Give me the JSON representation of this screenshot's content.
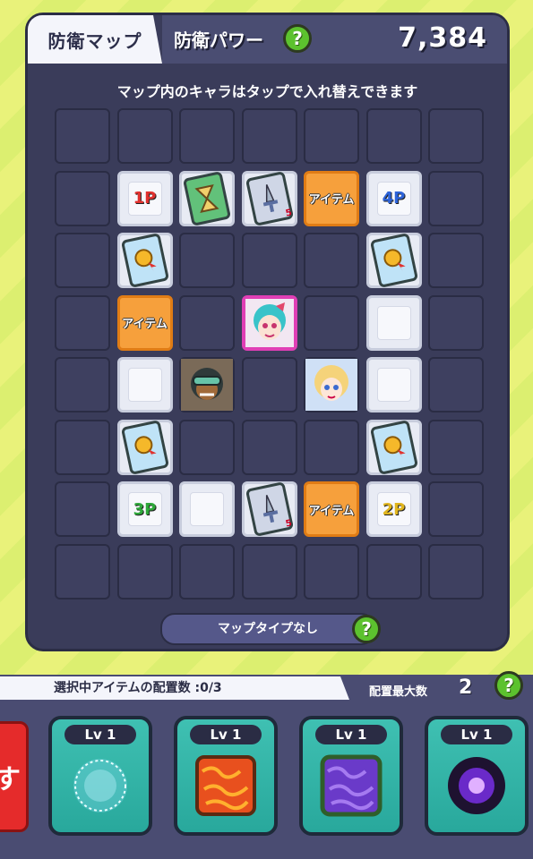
{
  "header": {
    "tab_title": "防衛マップ",
    "power_label": "防衛パワー",
    "power_value": "7,384",
    "help": "?"
  },
  "instruction": "マップ内のキャラはタップで入れ替えできます",
  "grid": {
    "p1": "1P",
    "p2": "2P",
    "p3": "3P",
    "p4": "4P",
    "item_label": "アイテム",
    "sword_level": "5"
  },
  "map_type": {
    "label": "マップタイプなし",
    "help": "?"
  },
  "bottom": {
    "selected_items": "選択中アイテムの配置数 :0/3",
    "max_label": "配置最大数",
    "max_value": "2",
    "help": "?",
    "partial_button": "す"
  },
  "items": [
    {
      "level": "Lv 1",
      "icon": "wisp-orb-icon"
    },
    {
      "level": "Lv 1",
      "icon": "lava-block-icon"
    },
    {
      "level": "Lv 1",
      "icon": "poison-block-icon"
    },
    {
      "level": "Lv 1",
      "icon": "dark-orb-icon"
    }
  ],
  "colors": {
    "panel": "#3a3c5a",
    "item_tile": "#f6a03c",
    "help_green": "#5cc22e",
    "card_teal": "#3fc0b2",
    "red_button": "#e52b2b"
  }
}
